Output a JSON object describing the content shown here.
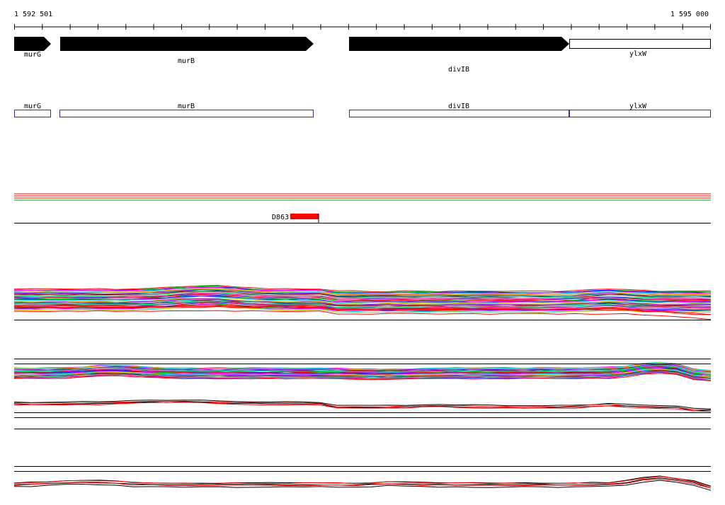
{
  "coordinate_range": {
    "start_label": "1 592 501",
    "end_label": "1 595 000"
  },
  "genes": [
    {
      "name": "murG",
      "strand": "+",
      "style": "filled"
    },
    {
      "name": "murB",
      "strand": "+",
      "style": "filled"
    },
    {
      "name": "divIB",
      "strand": "+",
      "style": "filled"
    },
    {
      "name": "ylxW",
      "strand": "+",
      "style": "outline"
    }
  ],
  "gene_boxes": [
    {
      "name": "murG",
      "color": "#2233bb"
    },
    {
      "name": "murB",
      "color": "#2233bb"
    },
    {
      "name": "divIB",
      "color": "#2233bb"
    },
    {
      "name": "ylxW",
      "color": "#2233bb"
    }
  ],
  "feature": {
    "label": "D863",
    "color": "#ff0000"
  },
  "track_colors": {
    "primary": "#ff0000",
    "secondary": "#00aa00",
    "dark": "#000000",
    "palette": [
      "#ff0000",
      "#00cc00",
      "#0000ff",
      "#ff00ff",
      "#00cccc",
      "#cccc00",
      "#ff8800",
      "#8800ff",
      "#008888",
      "#880000",
      "#888888",
      "#00ff88",
      "#ff0088",
      "#4444ff"
    ]
  }
}
